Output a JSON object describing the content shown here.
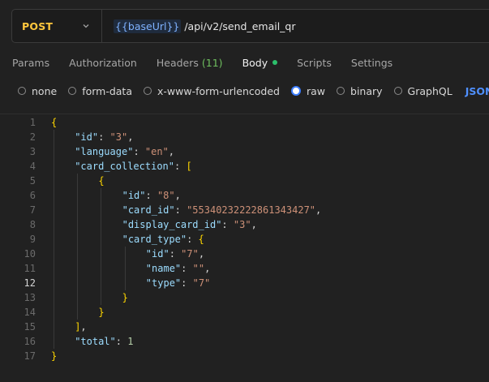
{
  "request": {
    "method": "POST",
    "url_variable": "{{baseUrl}}",
    "url_path": " /api/v2/send_email_qr"
  },
  "tabs": [
    {
      "label": "Params"
    },
    {
      "label": "Authorization"
    },
    {
      "label": "Headers",
      "count": "(11)"
    },
    {
      "label": "Body"
    },
    {
      "label": "Scripts"
    },
    {
      "label": "Settings"
    }
  ],
  "body_types": [
    {
      "label": "none",
      "checked": false
    },
    {
      "label": "form-data",
      "checked": false
    },
    {
      "label": "x-www-form-urlencoded",
      "checked": false
    },
    {
      "label": "raw",
      "checked": true
    },
    {
      "label": "binary",
      "checked": false
    },
    {
      "label": "GraphQL",
      "checked": false
    }
  ],
  "raw_format": "JSON",
  "editor": {
    "active_line": 12,
    "lines": [
      {
        "num": "1",
        "indent": 0,
        "tokens": [
          [
            "b",
            "{"
          ]
        ]
      },
      {
        "num": "2",
        "indent": 1,
        "tokens": [
          [
            "k",
            "\"id\""
          ],
          [
            "p",
            ": "
          ],
          [
            "s",
            "\"3\""
          ],
          [
            "p",
            ","
          ]
        ]
      },
      {
        "num": "3",
        "indent": 1,
        "tokens": [
          [
            "k",
            "\"language\""
          ],
          [
            "p",
            ": "
          ],
          [
            "s",
            "\"en\""
          ],
          [
            "p",
            ","
          ]
        ]
      },
      {
        "num": "4",
        "indent": 1,
        "tokens": [
          [
            "k",
            "\"card_collection\""
          ],
          [
            "p",
            ": "
          ],
          [
            "b",
            "["
          ]
        ]
      },
      {
        "num": "5",
        "indent": 2,
        "tokens": [
          [
            "b",
            "{"
          ]
        ]
      },
      {
        "num": "6",
        "indent": 3,
        "tokens": [
          [
            "k",
            "\"id\""
          ],
          [
            "p",
            ": "
          ],
          [
            "s",
            "\"8\""
          ],
          [
            "p",
            ","
          ]
        ]
      },
      {
        "num": "7",
        "indent": 3,
        "tokens": [
          [
            "k",
            "\"card_id\""
          ],
          [
            "p",
            ": "
          ],
          [
            "s",
            "\"55340232222861343427\""
          ],
          [
            "p",
            ","
          ]
        ]
      },
      {
        "num": "8",
        "indent": 3,
        "tokens": [
          [
            "k",
            "\"display_card_id\""
          ],
          [
            "p",
            ": "
          ],
          [
            "s",
            "\"3\""
          ],
          [
            "p",
            ","
          ]
        ]
      },
      {
        "num": "9",
        "indent": 3,
        "tokens": [
          [
            "k",
            "\"card_type\""
          ],
          [
            "p",
            ": "
          ],
          [
            "b",
            "{"
          ]
        ]
      },
      {
        "num": "10",
        "indent": 4,
        "tokens": [
          [
            "k",
            "\"id\""
          ],
          [
            "p",
            ": "
          ],
          [
            "s",
            "\"7\""
          ],
          [
            "p",
            ","
          ]
        ]
      },
      {
        "num": "11",
        "indent": 4,
        "tokens": [
          [
            "k",
            "\"name\""
          ],
          [
            "p",
            ": "
          ],
          [
            "s",
            "\"\""
          ],
          [
            "p",
            ","
          ]
        ]
      },
      {
        "num": "12",
        "indent": 4,
        "tokens": [
          [
            "k",
            "\"type\""
          ],
          [
            "p",
            ": "
          ],
          [
            "s",
            "\"7\""
          ]
        ]
      },
      {
        "num": "13",
        "indent": 3,
        "tokens": [
          [
            "b",
            "}"
          ]
        ]
      },
      {
        "num": "14",
        "indent": 2,
        "tokens": [
          [
            "b",
            "}"
          ]
        ]
      },
      {
        "num": "15",
        "indent": 1,
        "tokens": [
          [
            "b",
            "]"
          ],
          [
            "p",
            ","
          ]
        ]
      },
      {
        "num": "16",
        "indent": 1,
        "tokens": [
          [
            "k",
            "\"total\""
          ],
          [
            "p",
            ": "
          ],
          [
            "n",
            "1"
          ]
        ]
      },
      {
        "num": "17",
        "indent": 0,
        "tokens": [
          [
            "b",
            "}"
          ]
        ]
      }
    ]
  },
  "colors": {
    "method": "#ffc73d",
    "url_variable": "#7fb2ff",
    "headers_count": "#6fbf5f",
    "body_dot": "#2cbf6b",
    "radio_checked": "#3d7eff",
    "json_select": "#4f90ff",
    "json_key": "#9cdcfe",
    "json_string": "#ce9178",
    "json_number": "#b5cea8",
    "json_bracket": "#ffd700"
  },
  "icons": {
    "method_dropdown": "chevron-down-icon"
  }
}
